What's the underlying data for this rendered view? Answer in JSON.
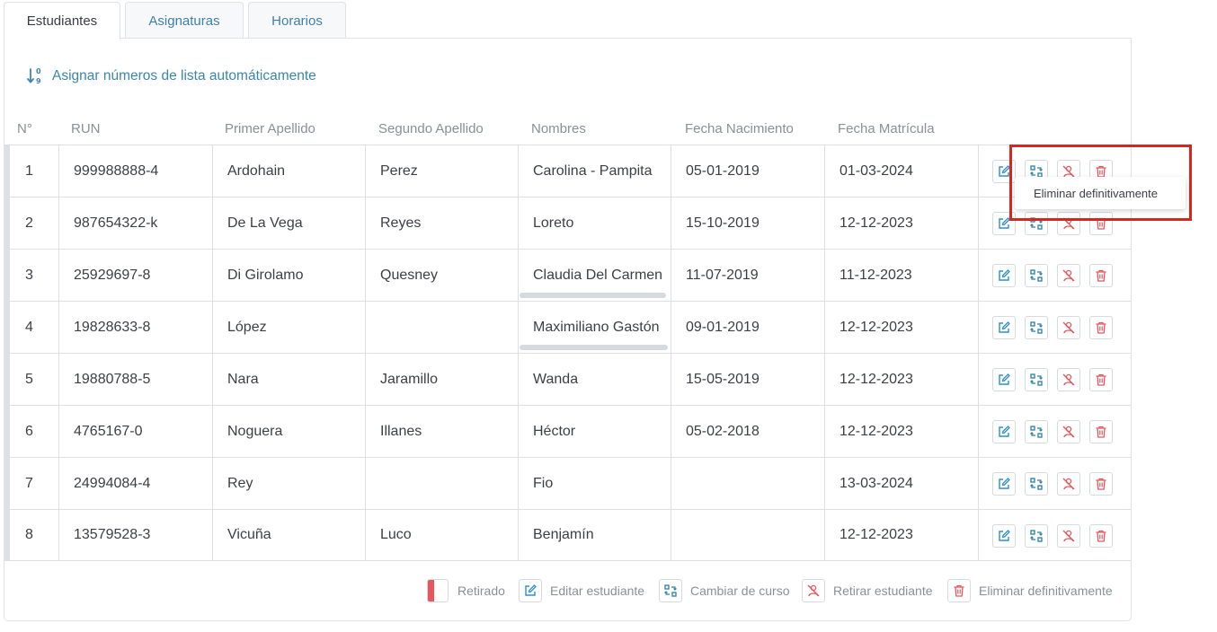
{
  "tabs": [
    {
      "label": "Estudiantes",
      "active": true
    },
    {
      "label": "Asignaturas",
      "active": false
    },
    {
      "label": "Horarios",
      "active": false
    }
  ],
  "auto_numbers_link": "Asignar números de lista automáticamente",
  "columns": [
    "N°",
    "RUN",
    "Primer Apellido",
    "Segundo Apellido",
    "Nombres",
    "Fecha Nacimiento",
    "Fecha Matrícula"
  ],
  "rows": [
    {
      "n": "1",
      "run": "999988888-4",
      "primer": "Ardohain",
      "segundo": "Perez",
      "nombres": "Carolina - Pampita",
      "nacimiento": "05-01-2019",
      "matricula": "01-03-2024"
    },
    {
      "n": "2",
      "run": "987654322-k",
      "primer": "De La Vega",
      "segundo": "Reyes",
      "nombres": "Loreto",
      "nacimiento": "15-10-2019",
      "matricula": "12-12-2023"
    },
    {
      "n": "3",
      "run": "25929697-8",
      "primer": "Di Girolamo",
      "segundo": "Quesney",
      "nombres": "Claudia Del Carmen",
      "nacimiento": "11-07-2019",
      "matricula": "11-12-2023"
    },
    {
      "n": "4",
      "run": "19828633-8",
      "primer": "López",
      "segundo": "",
      "nombres": "Maximiliano Gastón",
      "nacimiento": "09-01-2019",
      "matricula": "12-12-2023"
    },
    {
      "n": "5",
      "run": "19880788-5",
      "primer": "Nara",
      "segundo": "Jaramillo",
      "nombres": "Wanda",
      "nacimiento": "15-05-2019",
      "matricula": "12-12-2023"
    },
    {
      "n": "6",
      "run": "4765167-0",
      "primer": "Noguera",
      "segundo": "Illanes",
      "nombres": "Héctor",
      "nacimiento": "05-02-2018",
      "matricula": "12-12-2023"
    },
    {
      "n": "7",
      "run": "24994084-4",
      "primer": "Rey",
      "segundo": "",
      "nombres": "Fio",
      "nacimiento": "",
      "matricula": "13-03-2024"
    },
    {
      "n": "8",
      "run": "13579528-3",
      "primer": "Vicuña",
      "segundo": "Luco",
      "nombres": "Benjamín",
      "nacimiento": "",
      "matricula": "12-12-2023"
    }
  ],
  "tooltip": "Eliminar definitivamente",
  "legend": {
    "retirado": "Retirado",
    "editar": "Editar estudiante",
    "cambiar": "Cambiar de curso",
    "retirar": "Retirar estudiante",
    "eliminar": "Eliminar definitivamente"
  },
  "colors": {
    "link_blue": "#3b86ad",
    "edit_blue": "#2f8fd1",
    "change_teal": "#2a7fa8",
    "danger_red": "#e4575c",
    "highlight_red": "#d7261e"
  }
}
